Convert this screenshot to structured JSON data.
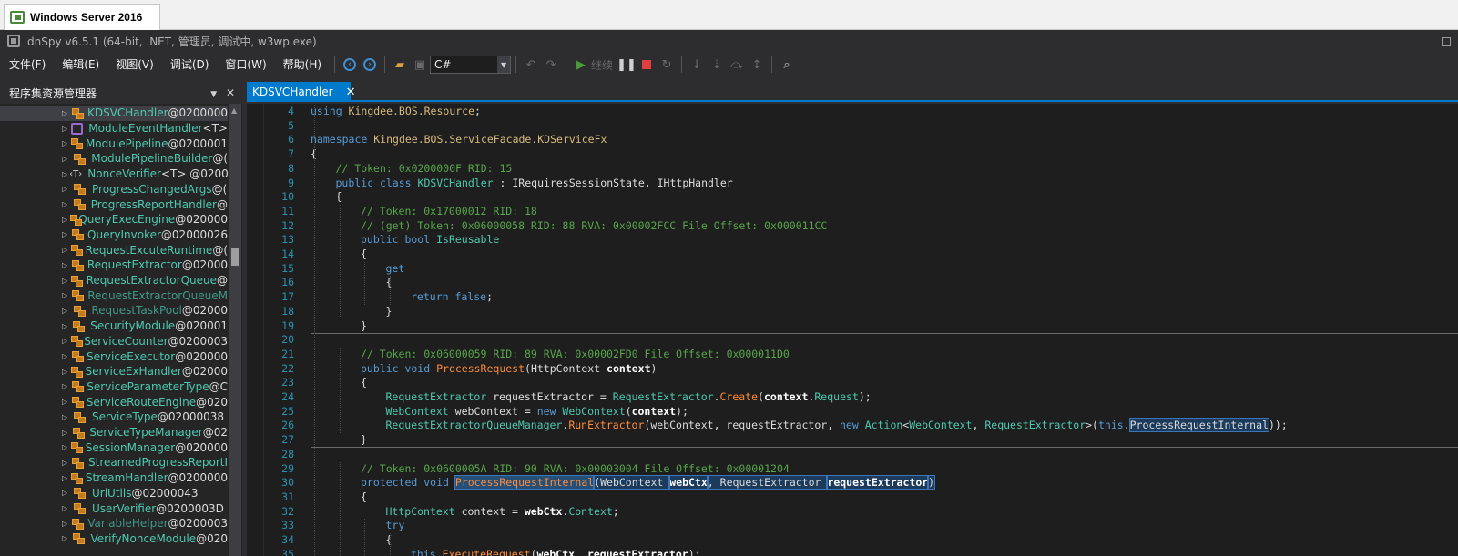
{
  "host": {
    "tab_title": "Windows Server 2016"
  },
  "window": {
    "title": "dnSpy v6.5.1 (64-bit, .NET, 管理员, 调试中, w3wp.exe)"
  },
  "menu": [
    "文件(F)",
    "编辑(E)",
    "视图(V)",
    "调试(D)",
    "窗口(W)",
    "帮助(H)"
  ],
  "toolbar": {
    "language": "C#",
    "continue_label": "继续"
  },
  "left_panel": {
    "title": "程序集资源管理器",
    "items": [
      {
        "name": "KDSVCHandler",
        "token": "@0200000",
        "icon": "class-icon",
        "selected": true
      },
      {
        "name": "ModuleEventHandler",
        "token": "<T>",
        "icon": "interface-icon"
      },
      {
        "name": "ModulePipeline",
        "token": "@0200001",
        "icon": "class-icon"
      },
      {
        "name": "ModulePipelineBuilder",
        "token": "@(",
        "icon": "class-icon"
      },
      {
        "name": "NonceVerifier",
        "token": "<T> @0200",
        "icon": "generic-icon"
      },
      {
        "name": "ProgressChangedArgs",
        "token": "@(",
        "icon": "class-icon"
      },
      {
        "name": "ProgressReportHandler",
        "token": "@",
        "icon": "class-icon"
      },
      {
        "name": "QueryExecEngine",
        "token": "@020000",
        "icon": "class-icon"
      },
      {
        "name": "QueryInvoker",
        "token": "@02000026",
        "icon": "class-icon"
      },
      {
        "name": "RequestExcuteRuntime",
        "token": "@(",
        "icon": "class-icon"
      },
      {
        "name": "RequestExtractor",
        "token": "@02000",
        "icon": "class-icon"
      },
      {
        "name": "RequestExtractorQueue",
        "token": "@",
        "icon": "class-icon"
      },
      {
        "name": "RequestExtractorQueueM",
        "token": "",
        "icon": "class-icon",
        "dim": true
      },
      {
        "name": "RequestTaskPool",
        "token": "@02000",
        "icon": "class-icon",
        "dim": true
      },
      {
        "name": "SecurityModule",
        "token": "@020001",
        "icon": "class-icon"
      },
      {
        "name": "ServiceCounter",
        "token": "@0200003",
        "icon": "class-icon"
      },
      {
        "name": "ServiceExecutor",
        "token": "@020000",
        "icon": "class-icon"
      },
      {
        "name": "ServiceExHandler",
        "token": "@02000",
        "icon": "class-icon"
      },
      {
        "name": "ServiceParameterType",
        "token": "@C",
        "icon": "class-icon"
      },
      {
        "name": "ServiceRouteEngine",
        "token": "@020",
        "icon": "class-icon"
      },
      {
        "name": "ServiceType",
        "token": "@02000038",
        "icon": "class-icon"
      },
      {
        "name": "ServiceTypeManager",
        "token": "@02",
        "icon": "class-icon"
      },
      {
        "name": "SessionManager",
        "token": "@020000",
        "icon": "class-icon"
      },
      {
        "name": "StreamedProgressReportI",
        "token": "",
        "icon": "class-icon"
      },
      {
        "name": "StreamHandler",
        "token": "@0200000",
        "icon": "class-icon"
      },
      {
        "name": "UriUtils",
        "token": "@02000043",
        "icon": "class-icon"
      },
      {
        "name": "UserVerifier",
        "token": "@0200003D",
        "icon": "class-icon"
      },
      {
        "name": "VariableHelper",
        "token": "@0200003",
        "icon": "class-icon",
        "dim": true
      },
      {
        "name": "VerifyNonceModule",
        "token": "@020",
        "icon": "class-icon"
      }
    ]
  },
  "editor": {
    "tab_title": "KDSVCHandler",
    "lines": [
      {
        "n": "4",
        "ind": 0,
        "seg": [
          [
            "kw",
            "using "
          ],
          [
            "ns",
            "Kingdee.BOS.Resource"
          ],
          [
            "",
            "; "
          ]
        ]
      },
      {
        "n": "5",
        "ind": 0,
        "seg": []
      },
      {
        "n": "6",
        "ind": 0,
        "seg": [
          [
            "kw",
            "namespace "
          ],
          [
            "ns",
            "Kingdee.BOS.ServiceFacade.KDServiceFx"
          ]
        ]
      },
      {
        "n": "7",
        "ind": 0,
        "seg": [
          [
            "",
            "{"
          ]
        ]
      },
      {
        "n": "8",
        "ind": 1,
        "seg": [
          [
            "cm",
            "// Token: 0x0200000F RID: 15"
          ]
        ]
      },
      {
        "n": "9",
        "ind": 1,
        "seg": [
          [
            "kw",
            "public class "
          ],
          [
            "ty",
            "KDSVCHandler"
          ],
          [
            "",
            " : IRequiresSessionState, IHttpHandler"
          ]
        ]
      },
      {
        "n": "10",
        "ind": 1,
        "seg": [
          [
            "",
            "{"
          ]
        ]
      },
      {
        "n": "11",
        "ind": 2,
        "seg": [
          [
            "cm",
            "// Token: 0x17000012 RID: 18"
          ]
        ]
      },
      {
        "n": "12",
        "ind": 2,
        "seg": [
          [
            "cm",
            "// (get) Token: 0x06000058 RID: 88 RVA: 0x00002FCC File Offset: 0x000011CC"
          ]
        ]
      },
      {
        "n": "13",
        "ind": 2,
        "seg": [
          [
            "kw",
            "public bool "
          ],
          [
            "pr",
            "IsReusable"
          ]
        ]
      },
      {
        "n": "14",
        "ind": 2,
        "seg": [
          [
            "",
            "{"
          ]
        ]
      },
      {
        "n": "15",
        "ind": 3,
        "seg": [
          [
            "kw",
            "get"
          ]
        ]
      },
      {
        "n": "16",
        "ind": 3,
        "seg": [
          [
            "",
            "{"
          ]
        ]
      },
      {
        "n": "17",
        "ind": 4,
        "seg": [
          [
            "kw",
            "return false"
          ],
          [
            "",
            ";"
          ]
        ]
      },
      {
        "n": "18",
        "ind": 3,
        "seg": [
          [
            "",
            "}"
          ]
        ]
      },
      {
        "n": "19",
        "ind": 2,
        "seg": [
          [
            "",
            "}"
          ]
        ],
        "rule_after": true
      },
      {
        "n": "20",
        "ind": 0,
        "seg": []
      },
      {
        "n": "21",
        "ind": 2,
        "seg": [
          [
            "cm",
            "// Token: 0x06000059 RID: 89 RVA: 0x00002FD0 File Offset: 0x000011D0"
          ]
        ]
      },
      {
        "n": "22",
        "ind": 2,
        "seg": [
          [
            "kw",
            "public void "
          ],
          [
            "me",
            "ProcessRequest"
          ],
          [
            "",
            "(HttpContext "
          ],
          [
            "bd",
            "context"
          ],
          [
            "",
            ")"
          ]
        ]
      },
      {
        "n": "23",
        "ind": 2,
        "seg": [
          [
            "",
            "{"
          ]
        ]
      },
      {
        "n": "24",
        "ind": 3,
        "seg": [
          [
            "ty",
            "RequestExtractor"
          ],
          [
            "",
            " requestExtractor = "
          ],
          [
            "ty",
            "RequestExtractor"
          ],
          [
            "",
            "."
          ],
          [
            "me",
            "Create"
          ],
          [
            "",
            "("
          ],
          [
            "bd",
            "context"
          ],
          [
            "",
            "."
          ],
          [
            "ty",
            "Request"
          ],
          [
            "",
            ");"
          ]
        ]
      },
      {
        "n": "25",
        "ind": 3,
        "seg": [
          [
            "ty",
            "WebContext"
          ],
          [
            "",
            " webContext = "
          ],
          [
            "kw",
            "new "
          ],
          [
            "ty",
            "WebContext"
          ],
          [
            "",
            "("
          ],
          [
            "bd",
            "context"
          ],
          [
            "",
            ");"
          ]
        ]
      },
      {
        "n": "26",
        "ind": 3,
        "seg": [
          [
            "ty",
            "RequestExtractorQueueManager"
          ],
          [
            "",
            "."
          ],
          [
            "me",
            "RunExtractor"
          ],
          [
            "",
            "(webContext, requestExtractor, "
          ],
          [
            "kw",
            "new "
          ],
          [
            "ty",
            "Action"
          ],
          [
            "",
            "<"
          ],
          [
            "ty",
            "WebContext"
          ],
          [
            "",
            ", "
          ],
          [
            "ty",
            "RequestExtractor"
          ],
          [
            "",
            ">("
          ],
          [
            "kw",
            "this"
          ],
          [
            "",
            "."
          ],
          [
            "hl2",
            "ProcessRequestInternal"
          ],
          [
            "",
            "));"
          ]
        ]
      },
      {
        "n": "27",
        "ind": 2,
        "seg": [
          [
            "",
            "}"
          ]
        ],
        "rule_after": true
      },
      {
        "n": "28",
        "ind": 0,
        "seg": []
      },
      {
        "n": "29",
        "ind": 2,
        "seg": [
          [
            "cm",
            "// Token: 0x0600005A RID: 90 RVA: 0x00003004 File Offset: 0x00001204"
          ]
        ]
      },
      {
        "n": "30",
        "ind": 2,
        "seg": [
          [
            "kw",
            "protected void "
          ],
          [
            "hl",
            "ProcessRequestInternal"
          ],
          [
            "hl2",
            "(WebContext "
          ],
          [
            "hl2b",
            "webCtx"
          ],
          [
            "hl2",
            ", RequestExtractor "
          ],
          [
            "hl2b",
            "requestExtractor"
          ],
          [
            "hl2",
            ")"
          ]
        ]
      },
      {
        "n": "31",
        "ind": 2,
        "seg": [
          [
            "",
            "{"
          ]
        ]
      },
      {
        "n": "32",
        "ind": 3,
        "seg": [
          [
            "ty",
            "HttpContext"
          ],
          [
            "",
            " context = "
          ],
          [
            "bd",
            "webCtx"
          ],
          [
            "",
            "."
          ],
          [
            "ty",
            "Context"
          ],
          [
            "",
            ";"
          ]
        ]
      },
      {
        "n": "33",
        "ind": 3,
        "seg": [
          [
            "kw",
            "try"
          ]
        ]
      },
      {
        "n": "34",
        "ind": 3,
        "seg": [
          [
            "",
            "{"
          ]
        ]
      },
      {
        "n": "35",
        "ind": 4,
        "seg": [
          [
            "kw",
            "this"
          ],
          [
            "",
            "."
          ],
          [
            "me",
            "ExecuteRequest"
          ],
          [
            "",
            "("
          ],
          [
            "bd",
            "webCtx"
          ],
          [
            "",
            ", "
          ],
          [
            "bd",
            "requestExtractor"
          ],
          [
            "",
            ");"
          ]
        ]
      },
      {
        "n": "36",
        "ind": 3,
        "seg": [
          [
            "",
            "}"
          ]
        ]
      }
    ]
  }
}
